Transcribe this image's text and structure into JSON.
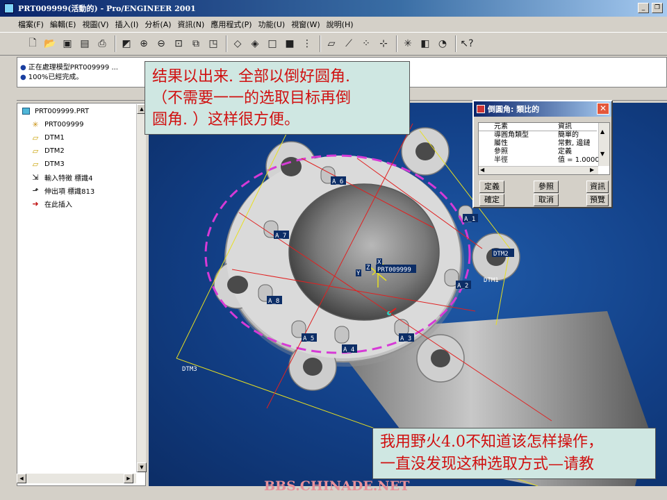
{
  "window": {
    "title": "PRT009999(活動的) - Pro/ENGINEER 2001",
    "minimize_glyph": "_",
    "restore_glyph": "❐"
  },
  "menu": [
    "檔案(F)",
    "編輯(E)",
    "視圖(V)",
    "插入(I)",
    "分析(A)",
    "資訊(N)",
    "應用程式(P)",
    "功能(U)",
    "視窗(W)",
    "說明(H)"
  ],
  "toolbar_icons": [
    "new-icon",
    "open-icon",
    "save-icon",
    "save-copy-icon",
    "print-icon",
    "repaint-icon",
    "zoom-in-icon",
    "zoom-out-icon",
    "refit-icon",
    "orient-icon",
    "view-manager-icon",
    "wireframe-icon",
    "hidden-line-icon",
    "no-hidden-icon",
    "shading-icon",
    "model-tree-icon",
    "datum-planes-icon",
    "datum-axes-icon",
    "datum-points-icon",
    "coordinate-systems-icon",
    "spin-center-icon",
    "layer-icon",
    "orientation-icon",
    "context-help-icon"
  ],
  "messages": [
    "正在處理模型PRT009999 ...",
    "100%已經完成。"
  ],
  "model_tree": {
    "items": [
      {
        "label": "PRT009999.PRT",
        "icon": "part-icon"
      },
      {
        "label": "PRT009999",
        "icon": "csys-icon"
      },
      {
        "label": "DTM1",
        "icon": "datum-plane-icon"
      },
      {
        "label": "DTM2",
        "icon": "datum-plane-icon"
      },
      {
        "label": "DTM3",
        "icon": "datum-plane-icon"
      },
      {
        "label": "輸入特徵 標識4",
        "icon": "import-feature-icon"
      },
      {
        "label": "伸出項 標識813",
        "icon": "protrusion-icon"
      },
      {
        "label": "在此插入",
        "icon": "insert-here-arrow-icon"
      }
    ]
  },
  "annotations": {
    "top": [
      "结果以出来. 全部以倒好圆角.",
      "（不需要一一的选取目标再倒",
      "圆角. ）这样很方便。"
    ],
    "bottom": [
      "我用野火4.0不知道该怎样操作，",
      "一直没发现这种选取方式—请教"
    ]
  },
  "watermark": "BBS.CHINADE.NET",
  "viewport_labels": {
    "datums": [
      "DTM1",
      "DTM2",
      "DTM3"
    ],
    "axes": [
      "A_1",
      "A_2",
      "A_3",
      "A_4",
      "A_5",
      "A_6",
      "A_7",
      "A_8"
    ],
    "csys_name": "PRT009999",
    "csys_axes": [
      "X",
      "Y",
      "Z"
    ]
  },
  "dialog": {
    "title": "倒圓角: 類比的",
    "close_glyph": "✕",
    "columns": [
      "元素",
      "資訊"
    ],
    "rows": [
      {
        "element": "導圓角類型",
        "info": "簡單的"
      },
      {
        "element": "屬性",
        "info": "常數, 邊鏈"
      },
      {
        "element": "參照",
        "info": "定義"
      },
      {
        "element": "半徑",
        "info": "值 = 1.0000"
      }
    ],
    "buttons_row1": [
      "定義",
      "參照",
      "資訊"
    ],
    "buttons_row2": [
      "確定",
      "取消",
      "預覽"
    ]
  },
  "colors": {
    "annotation_text": "#d01010",
    "annotation_bg": "#cfe7e2",
    "viewport_bg": "#123f86",
    "datum_plane_line": "#e8e020",
    "axis_line": "#e02020",
    "dashed_ellipse": "#d63ad6",
    "title_bar": "#0a246a"
  }
}
